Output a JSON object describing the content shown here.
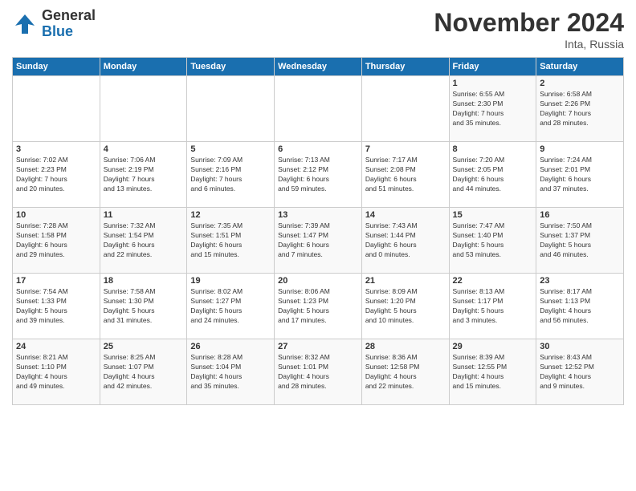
{
  "header": {
    "logo_general": "General",
    "logo_blue": "Blue",
    "month_title": "November 2024",
    "location": "Inta, Russia"
  },
  "days_of_week": [
    "Sunday",
    "Monday",
    "Tuesday",
    "Wednesday",
    "Thursday",
    "Friday",
    "Saturday"
  ],
  "weeks": [
    [
      {
        "day": "",
        "info": ""
      },
      {
        "day": "",
        "info": ""
      },
      {
        "day": "",
        "info": ""
      },
      {
        "day": "",
        "info": ""
      },
      {
        "day": "",
        "info": ""
      },
      {
        "day": "1",
        "info": "Sunrise: 6:55 AM\nSunset: 2:30 PM\nDaylight: 7 hours\nand 35 minutes."
      },
      {
        "day": "2",
        "info": "Sunrise: 6:58 AM\nSunset: 2:26 PM\nDaylight: 7 hours\nand 28 minutes."
      }
    ],
    [
      {
        "day": "3",
        "info": "Sunrise: 7:02 AM\nSunset: 2:23 PM\nDaylight: 7 hours\nand 20 minutes."
      },
      {
        "day": "4",
        "info": "Sunrise: 7:06 AM\nSunset: 2:19 PM\nDaylight: 7 hours\nand 13 minutes."
      },
      {
        "day": "5",
        "info": "Sunrise: 7:09 AM\nSunset: 2:16 PM\nDaylight: 7 hours\nand 6 minutes."
      },
      {
        "day": "6",
        "info": "Sunrise: 7:13 AM\nSunset: 2:12 PM\nDaylight: 6 hours\nand 59 minutes."
      },
      {
        "day": "7",
        "info": "Sunrise: 7:17 AM\nSunset: 2:08 PM\nDaylight: 6 hours\nand 51 minutes."
      },
      {
        "day": "8",
        "info": "Sunrise: 7:20 AM\nSunset: 2:05 PM\nDaylight: 6 hours\nand 44 minutes."
      },
      {
        "day": "9",
        "info": "Sunrise: 7:24 AM\nSunset: 2:01 PM\nDaylight: 6 hours\nand 37 minutes."
      }
    ],
    [
      {
        "day": "10",
        "info": "Sunrise: 7:28 AM\nSunset: 1:58 PM\nDaylight: 6 hours\nand 29 minutes."
      },
      {
        "day": "11",
        "info": "Sunrise: 7:32 AM\nSunset: 1:54 PM\nDaylight: 6 hours\nand 22 minutes."
      },
      {
        "day": "12",
        "info": "Sunrise: 7:35 AM\nSunset: 1:51 PM\nDaylight: 6 hours\nand 15 minutes."
      },
      {
        "day": "13",
        "info": "Sunrise: 7:39 AM\nSunset: 1:47 PM\nDaylight: 6 hours\nand 7 minutes."
      },
      {
        "day": "14",
        "info": "Sunrise: 7:43 AM\nSunset: 1:44 PM\nDaylight: 6 hours\nand 0 minutes."
      },
      {
        "day": "15",
        "info": "Sunrise: 7:47 AM\nSunset: 1:40 PM\nDaylight: 5 hours\nand 53 minutes."
      },
      {
        "day": "16",
        "info": "Sunrise: 7:50 AM\nSunset: 1:37 PM\nDaylight: 5 hours\nand 46 minutes."
      }
    ],
    [
      {
        "day": "17",
        "info": "Sunrise: 7:54 AM\nSunset: 1:33 PM\nDaylight: 5 hours\nand 39 minutes."
      },
      {
        "day": "18",
        "info": "Sunrise: 7:58 AM\nSunset: 1:30 PM\nDaylight: 5 hours\nand 31 minutes."
      },
      {
        "day": "19",
        "info": "Sunrise: 8:02 AM\nSunset: 1:27 PM\nDaylight: 5 hours\nand 24 minutes."
      },
      {
        "day": "20",
        "info": "Sunrise: 8:06 AM\nSunset: 1:23 PM\nDaylight: 5 hours\nand 17 minutes."
      },
      {
        "day": "21",
        "info": "Sunrise: 8:09 AM\nSunset: 1:20 PM\nDaylight: 5 hours\nand 10 minutes."
      },
      {
        "day": "22",
        "info": "Sunrise: 8:13 AM\nSunset: 1:17 PM\nDaylight: 5 hours\nand 3 minutes."
      },
      {
        "day": "23",
        "info": "Sunrise: 8:17 AM\nSunset: 1:13 PM\nDaylight: 4 hours\nand 56 minutes."
      }
    ],
    [
      {
        "day": "24",
        "info": "Sunrise: 8:21 AM\nSunset: 1:10 PM\nDaylight: 4 hours\nand 49 minutes."
      },
      {
        "day": "25",
        "info": "Sunrise: 8:25 AM\nSunset: 1:07 PM\nDaylight: 4 hours\nand 42 minutes."
      },
      {
        "day": "26",
        "info": "Sunrise: 8:28 AM\nSunset: 1:04 PM\nDaylight: 4 hours\nand 35 minutes."
      },
      {
        "day": "27",
        "info": "Sunrise: 8:32 AM\nSunset: 1:01 PM\nDaylight: 4 hours\nand 28 minutes."
      },
      {
        "day": "28",
        "info": "Sunrise: 8:36 AM\nSunset: 12:58 PM\nDaylight: 4 hours\nand 22 minutes."
      },
      {
        "day": "29",
        "info": "Sunrise: 8:39 AM\nSunset: 12:55 PM\nDaylight: 4 hours\nand 15 minutes."
      },
      {
        "day": "30",
        "info": "Sunrise: 8:43 AM\nSunset: 12:52 PM\nDaylight: 4 hours\nand 9 minutes."
      }
    ]
  ]
}
